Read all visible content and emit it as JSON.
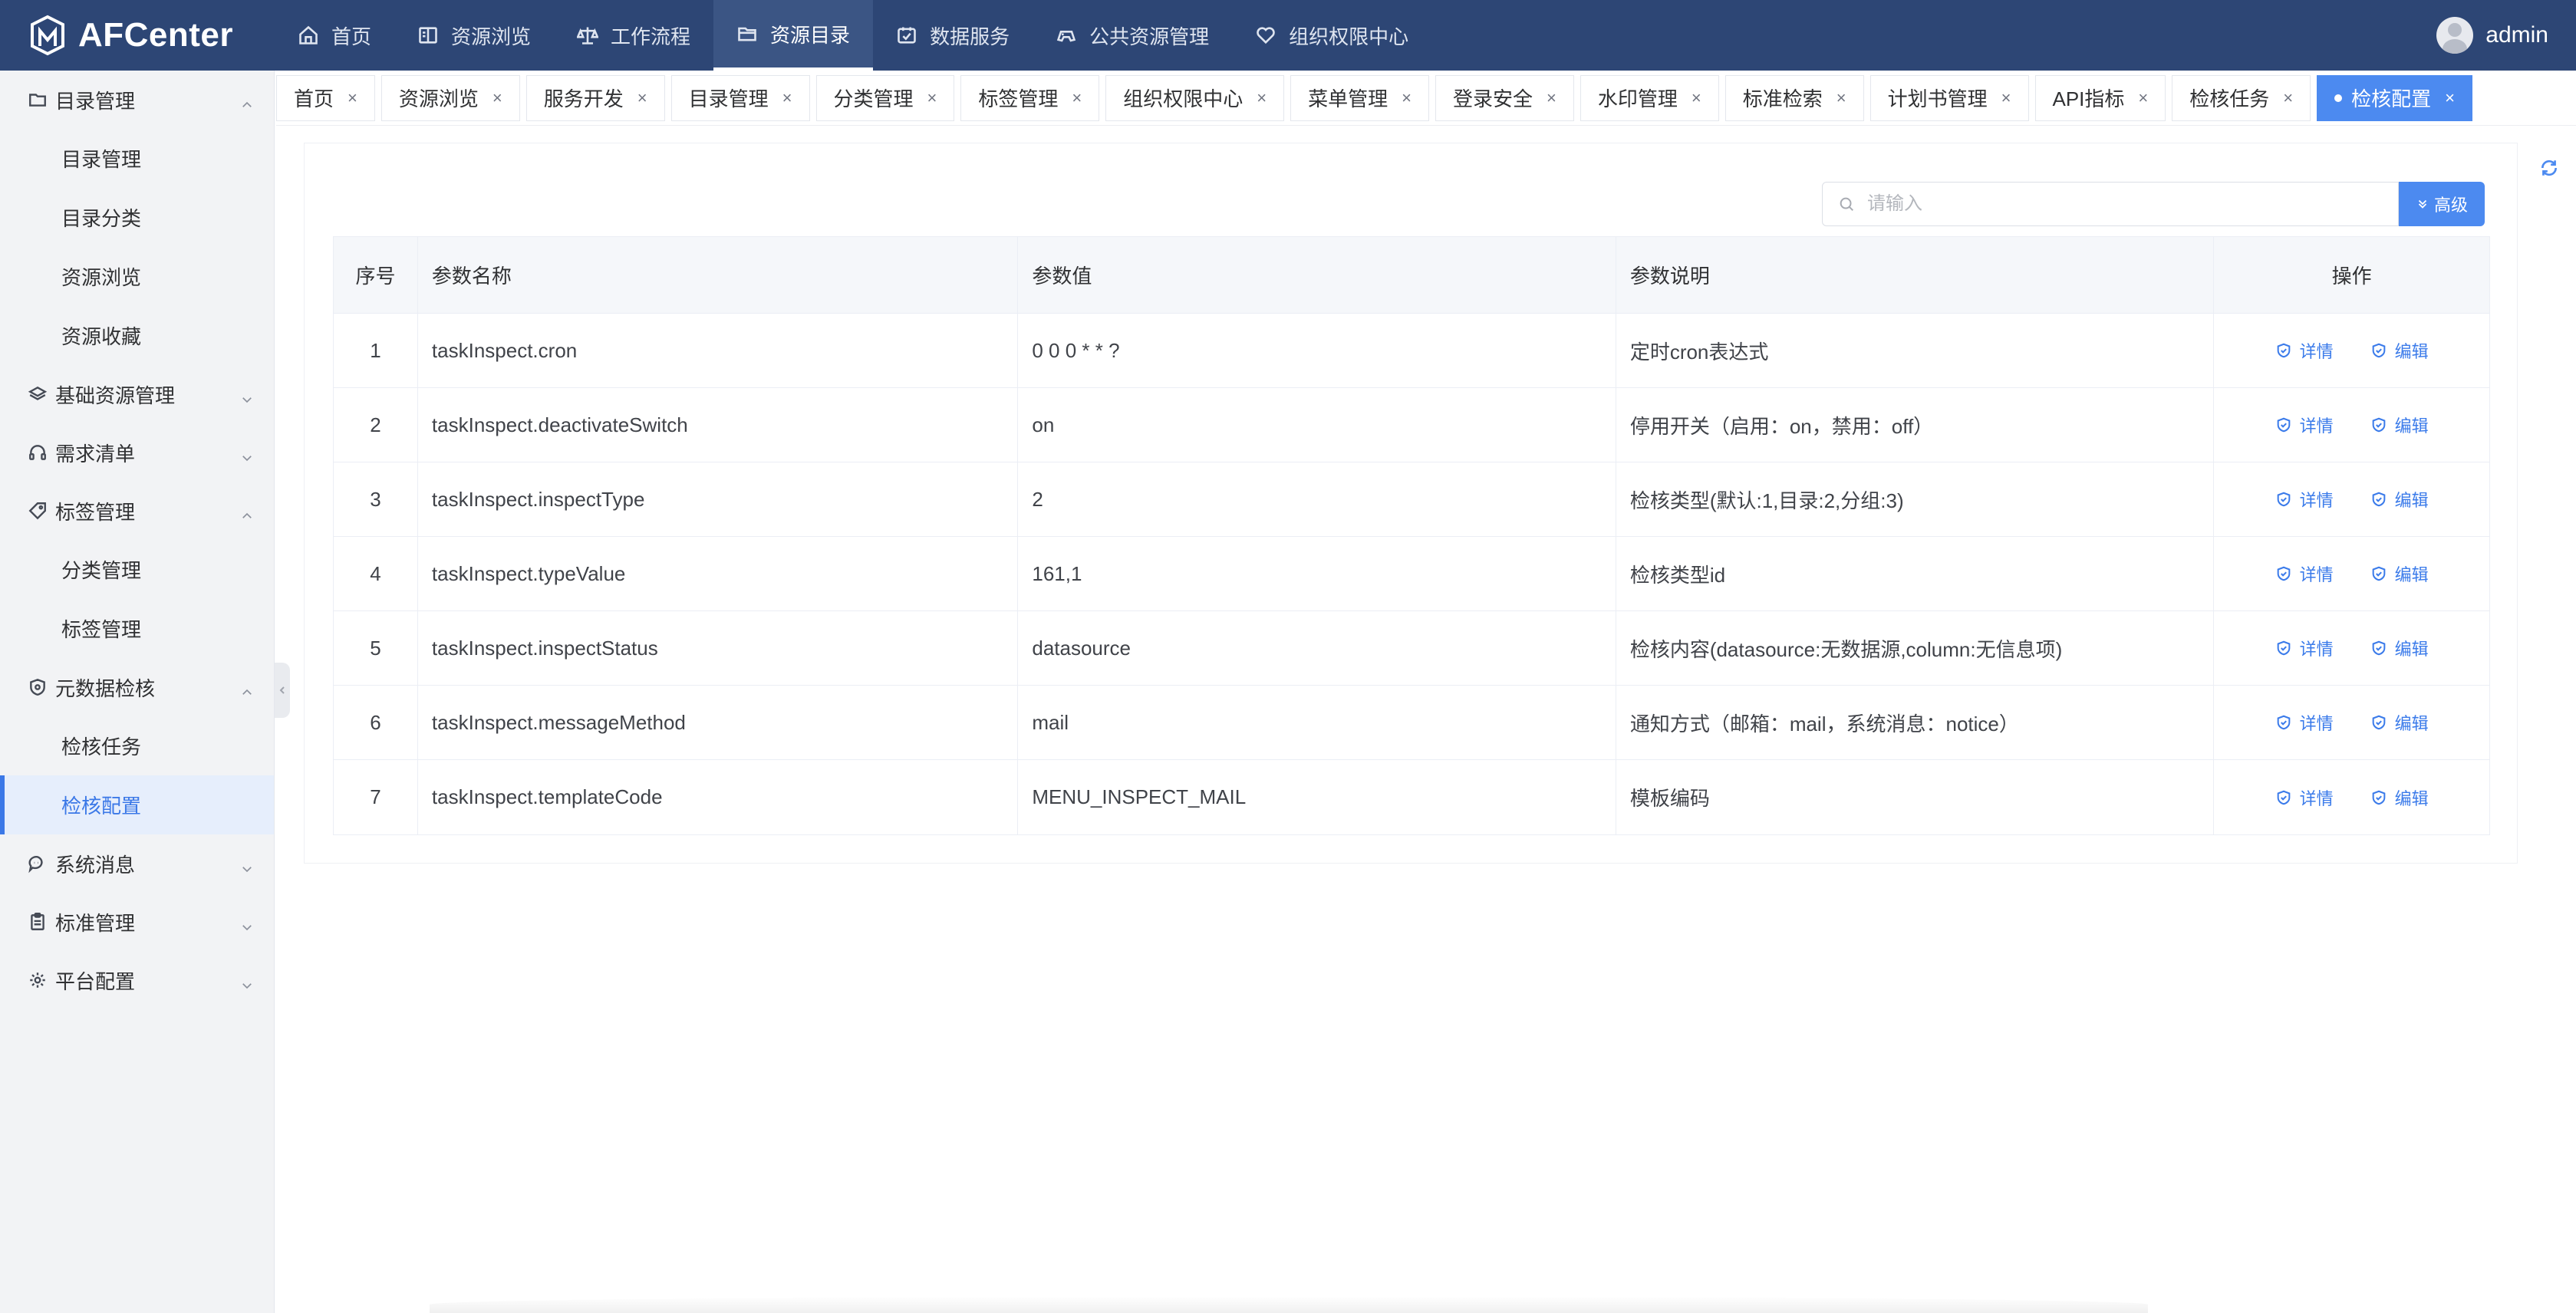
{
  "app": {
    "name": "AFCenter",
    "user": "admin"
  },
  "topnav": [
    {
      "label": "首页",
      "icon": "home-icon"
    },
    {
      "label": "资源浏览",
      "icon": "book-icon"
    },
    {
      "label": "工作流程",
      "icon": "scale-icon"
    },
    {
      "label": "资源目录",
      "icon": "folder-icon",
      "active": true
    },
    {
      "label": "数据服务",
      "icon": "calendar-check-icon"
    },
    {
      "label": "公共资源管理",
      "icon": "gamepad-icon"
    },
    {
      "label": "组织权限中心",
      "icon": "heart-icon"
    }
  ],
  "sidebar": {
    "g1": "目录管理",
    "s1": "目录管理",
    "s2": "目录分类",
    "s3": "资源浏览",
    "s4": "资源收藏",
    "g2": "基础资源管理",
    "g3": "需求清单",
    "g4": "标签管理",
    "s5": "分类管理",
    "s6": "标签管理",
    "g5": "元数据检核",
    "s7": "检核任务",
    "s8": "检核配置",
    "g6": "系统消息",
    "g7": "标准管理",
    "g8": "平台配置"
  },
  "tabs": [
    "首页",
    "资源浏览",
    "服务开发",
    "目录管理",
    "分类管理",
    "标签管理",
    "组织权限中心",
    "菜单管理",
    "登录安全",
    "水印管理",
    "标准检索",
    "计划书管理",
    "API指标",
    "检核任务",
    "检核配置"
  ],
  "search": {
    "placeholder": "请输入",
    "advanced_label": "高级"
  },
  "table": {
    "headers": [
      "序号",
      "参数名称",
      "参数值",
      "参数说明",
      "操作"
    ],
    "rows": [
      {
        "no": "1",
        "name": "taskInspect.cron",
        "value": "0 0 0 * * ?",
        "desc": "定时cron表达式"
      },
      {
        "no": "2",
        "name": "taskInspect.deactivateSwitch",
        "value": "on",
        "desc": "停用开关（启用：on，禁用：off）"
      },
      {
        "no": "3",
        "name": "taskInspect.inspectType",
        "value": "2",
        "desc": "检核类型(默认:1,目录:2,分组:3)"
      },
      {
        "no": "4",
        "name": "taskInspect.typeValue",
        "value": "161,1",
        "desc": "检核类型id"
      },
      {
        "no": "5",
        "name": "taskInspect.inspectStatus",
        "value": "datasource",
        "desc": "检核内容(datasource:无数据源,column:无信息项)"
      },
      {
        "no": "6",
        "name": "taskInspect.messageMethod",
        "value": "mail",
        "desc": "通知方式（邮箱：mail，系统消息：notice）"
      },
      {
        "no": "7",
        "name": "taskInspect.templateCode",
        "value": "MENU_INSPECT_MAIL",
        "desc": "模板编码"
      }
    ],
    "op_detail": "详情",
    "op_edit": "编辑"
  },
  "colors": {
    "topbar": "#2d4675",
    "primary": "#4c8af0",
    "link": "#3b7bea"
  }
}
